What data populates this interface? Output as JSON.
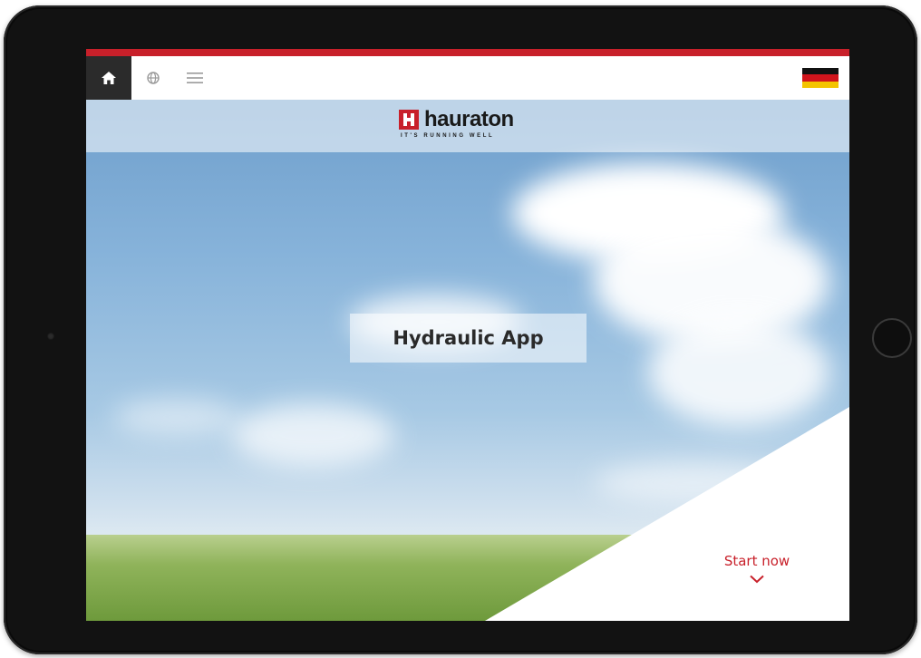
{
  "nav": {
    "home_icon": "home-icon",
    "globe_icon": "globe-icon",
    "menu_icon": "menu-icon",
    "language_flag": "german-flag"
  },
  "brand": {
    "name": "hauraton",
    "slogan": "IT'S RUNNING WELL",
    "accent_color": "#c8202a"
  },
  "hero": {
    "title": "Hydraulic App"
  },
  "cta": {
    "label": "Start now",
    "icon": "chevron-down-icon"
  },
  "colors": {
    "accent": "#c8202a",
    "nav_active": "#2b2b2b",
    "device_frame": "#121212"
  }
}
